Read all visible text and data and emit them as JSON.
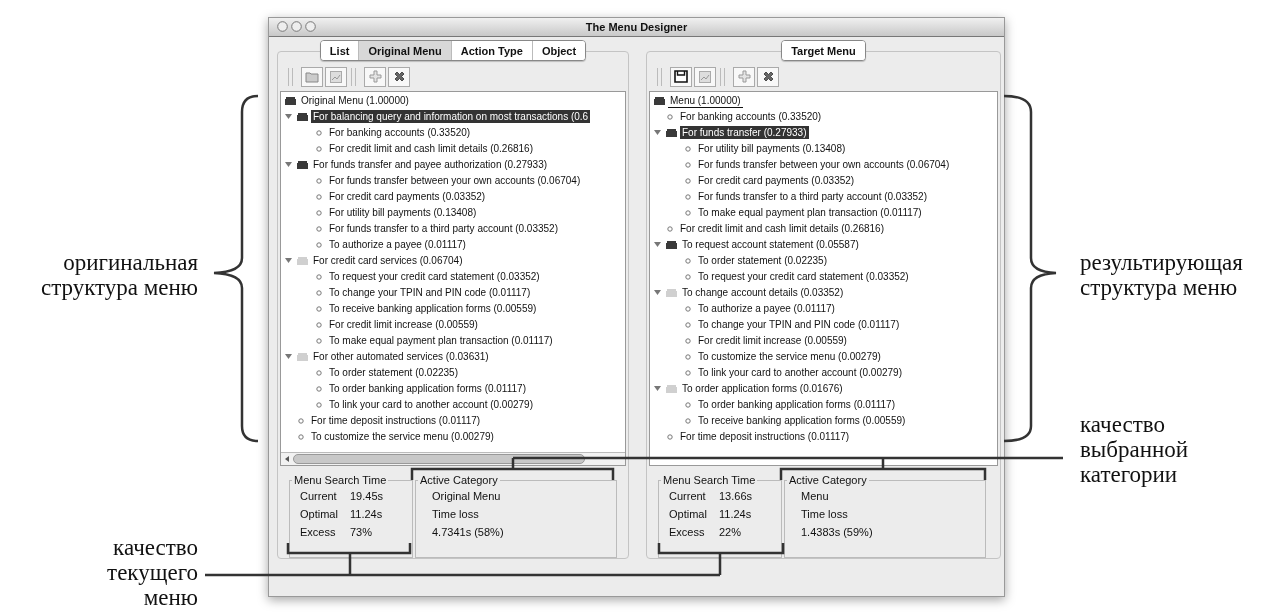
{
  "window": {
    "title": "The Menu Designer"
  },
  "panels": [
    {
      "tabs": [
        {
          "label": "List",
          "selected": false
        },
        {
          "label": "Original Menu",
          "selected": true
        },
        {
          "label": "Action Type",
          "selected": false
        },
        {
          "label": "Object",
          "selected": false
        }
      ],
      "tree": {
        "label": "Original Menu (1.00000)",
        "selected": false,
        "focused": false,
        "dimmed": false,
        "children": [
          {
            "label": "For balancing query and information on most transactions (0.6",
            "selected": true,
            "focused": false,
            "expanded": true,
            "dimmed": false,
            "children": [
              {
                "label": "For banking accounts (0.33520)",
                "selected": false,
                "focused": false
              },
              {
                "label": "For credit limit and cash limit details (0.26816)",
                "selected": false,
                "focused": false
              }
            ]
          },
          {
            "label": "For funds transfer and payee authorization (0.27933)",
            "selected": false,
            "focused": false,
            "expanded": true,
            "dimmed": false,
            "children": [
              {
                "label": "For funds transfer between your own accounts (0.06704)",
                "selected": false,
                "focused": false
              },
              {
                "label": "For credit card payments (0.03352)",
                "selected": false,
                "focused": false
              },
              {
                "label": "For utility bill payments (0.13408)",
                "selected": false,
                "focused": false
              },
              {
                "label": "For funds transfer to a third party account (0.03352)",
                "selected": false,
                "focused": false
              },
              {
                "label": "To authorize a payee (0.01117)",
                "selected": false,
                "focused": false
              }
            ]
          },
          {
            "label": "For credit card services (0.06704)",
            "selected": false,
            "focused": false,
            "expanded": true,
            "dimmed": true,
            "children": [
              {
                "label": "To request your credit card statement (0.03352)",
                "selected": false,
                "focused": false
              },
              {
                "label": "To change your TPIN and PIN code (0.01117)",
                "selected": false,
                "focused": false
              },
              {
                "label": "To receive banking application forms (0.00559)",
                "selected": false,
                "focused": false
              },
              {
                "label": "For credit limit increase (0.00559)",
                "selected": false,
                "focused": false
              },
              {
                "label": "To make equal payment plan transaction (0.01117)",
                "selected": false,
                "focused": false
              }
            ]
          },
          {
            "label": "For other automated services (0.03631)",
            "selected": false,
            "focused": false,
            "expanded": true,
            "dimmed": true,
            "children": [
              {
                "label": "To order statement (0.02235)",
                "selected": false,
                "focused": false
              },
              {
                "label": "To order banking application forms (0.01117)",
                "selected": false,
                "focused": false
              },
              {
                "label": "To link your card to another account (0.00279)",
                "selected": false,
                "focused": false
              }
            ]
          },
          {
            "label": "For time deposit instructions (0.01117)",
            "selected": false,
            "focused": false
          },
          {
            "label": "To customize the service menu (0.00279)",
            "selected": false,
            "focused": false
          }
        ]
      },
      "horizontal_scrollbar": true,
      "search_time": {
        "title": "Menu Search Time",
        "rows": [
          {
            "label": "Current",
            "value": "19.45s"
          },
          {
            "label": "Optimal",
            "value": "11.24s"
          },
          {
            "label": "Excess",
            "value": "73%"
          }
        ]
      },
      "active_category": {
        "title": "Active Category",
        "lines": [
          "Original Menu",
          "Time loss",
          "4.7341s (58%)"
        ]
      }
    },
    {
      "tabs": [
        {
          "label": "Target Menu",
          "selected": false
        }
      ],
      "tree": {
        "label": "Menu (1.00000)",
        "selected": false,
        "focused": true,
        "dimmed": false,
        "children": [
          {
            "label": "For banking accounts (0.33520)",
            "selected": false,
            "focused": false
          },
          {
            "label": "For funds transfer (0.27933)",
            "selected": true,
            "focused": false,
            "expanded": true,
            "dimmed": false,
            "children": [
              {
                "label": "For utility bill payments (0.13408)",
                "selected": false,
                "focused": false
              },
              {
                "label": "For funds transfer between your own accounts (0.06704)",
                "selected": false,
                "focused": false
              },
              {
                "label": "For credit card payments (0.03352)",
                "selected": false,
                "focused": false
              },
              {
                "label": "For funds transfer to a third party account (0.03352)",
                "selected": false,
                "focused": false
              },
              {
                "label": "To make equal payment plan transaction (0.01117)",
                "selected": false,
                "focused": false
              }
            ]
          },
          {
            "label": "For credit limit and cash limit details (0.26816)",
            "selected": false,
            "focused": false
          },
          {
            "label": "To request account statement (0.05587)",
            "selected": false,
            "focused": false,
            "expanded": true,
            "dimmed": false,
            "children": [
              {
                "label": "To order statement (0.02235)",
                "selected": false,
                "focused": false
              },
              {
                "label": "To request your credit card statement (0.03352)",
                "selected": false,
                "focused": false
              }
            ]
          },
          {
            "label": "To change account details (0.03352)",
            "selected": false,
            "focused": false,
            "expanded": true,
            "dimmed": true,
            "children": [
              {
                "label": "To authorize a payee (0.01117)",
                "selected": false,
                "focused": false
              },
              {
                "label": "To change your TPIN and PIN code (0.01117)",
                "selected": false,
                "focused": false
              },
              {
                "label": "For credit limit increase (0.00559)",
                "selected": false,
                "focused": false
              },
              {
                "label": "To customize the service menu (0.00279)",
                "selected": false,
                "focused": false
              },
              {
                "label": "To link your card to another account (0.00279)",
                "selected": false,
                "focused": false
              }
            ]
          },
          {
            "label": "To order application forms (0.01676)",
            "selected": false,
            "focused": false,
            "expanded": true,
            "dimmed": true,
            "children": [
              {
                "label": "To order banking application forms (0.01117)",
                "selected": false,
                "focused": false
              },
              {
                "label": "To receive banking application forms (0.00559)",
                "selected": false,
                "focused": false
              }
            ]
          },
          {
            "label": "For time deposit instructions (0.01117)",
            "selected": false,
            "focused": false
          }
        ]
      },
      "horizontal_scrollbar": false,
      "search_time": {
        "title": "Menu Search Time",
        "rows": [
          {
            "label": "Current",
            "value": "13.66s"
          },
          {
            "label": "Optimal",
            "value": "11.24s"
          },
          {
            "label": "Excess",
            "value": "22%"
          }
        ]
      },
      "active_category": {
        "title": "Active Category",
        "lines": [
          "Menu",
          "Time loss",
          "1.4383s (59%)"
        ]
      }
    }
  ],
  "annotations": {
    "left": [
      "оригинальная структура меню",
      "качество текущего меню"
    ],
    "right": [
      "результирующая структура меню",
      "качество выбранной категории"
    ]
  }
}
